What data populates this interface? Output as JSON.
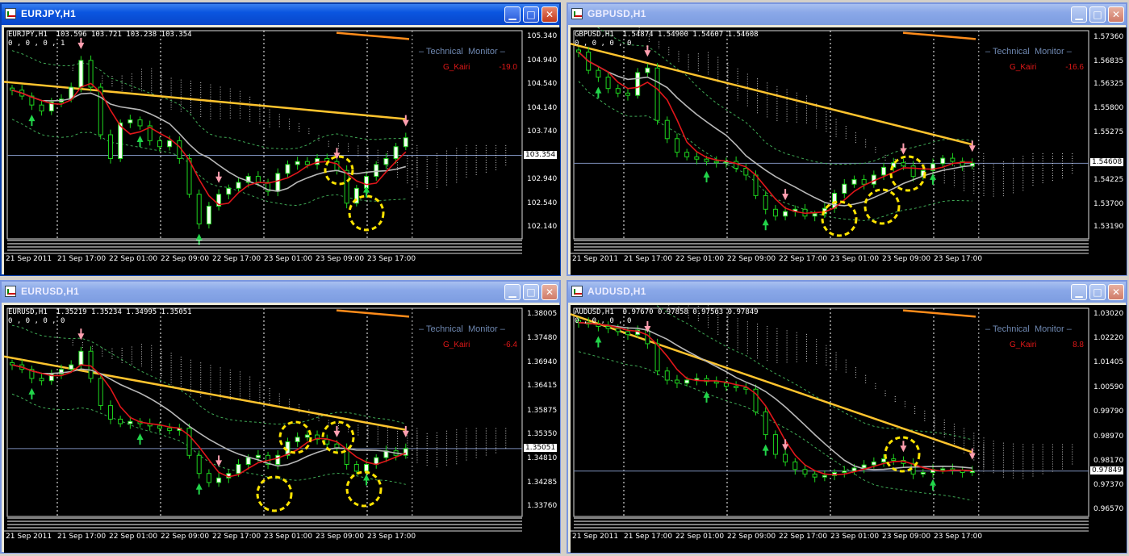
{
  "charts": [
    {
      "id": "eurjpy",
      "title": "EURJPY,H1",
      "active": true,
      "info_line1": "EURJPY,H1  103.596 103.721 103.238 103.354",
      "info_line2": "0 , 0 , 0 , 1",
      "monitor_label": "Technical  Monitor",
      "kairi_label": "G_Kairi",
      "kairi_value": "-19.0",
      "price_labels": [
        "105.340",
        "104.940",
        "104.540",
        "104.140",
        "103.740",
        "103.354",
        "102.940",
        "102.540",
        "102.140"
      ],
      "current_price": "103.354",
      "time_labels": [
        "21 Sep 2011",
        "21 Sep 17:00",
        "22 Sep 01:00",
        "22 Sep 09:00",
        "22 Sep 17:00",
        "23 Sep 01:00",
        "23 Sep 09:00",
        "23 Sep 17:00"
      ],
      "chart_data": {
        "type": "candlestick",
        "ylim": [
          101.95,
          105.45
        ],
        "current": 103.354,
        "close": [
          104.45,
          104.35,
          104.2,
          104.1,
          104.25,
          104.3,
          104.5,
          104.95,
          104.5,
          103.7,
          103.3,
          103.9,
          103.95,
          103.85,
          103.6,
          103.5,
          103.6,
          103.3,
          102.7,
          102.2,
          102.5,
          102.7,
          102.8,
          102.9,
          103.0,
          102.9,
          102.75,
          103.05,
          103.2,
          103.25,
          103.2,
          103.3,
          103.25,
          103.1,
          102.55,
          102.8,
          103.0,
          103.2,
          103.3,
          103.5,
          103.65
        ]
      },
      "circles": [
        [
          415,
          177,
          17
        ],
        [
          449,
          230,
          21
        ]
      ]
    },
    {
      "id": "gbpusd",
      "title": "GBPUSD,H1",
      "active": false,
      "info_line1": "GBPUSD,H1  1.54874 1.54900 1.54607 1.54608",
      "info_line2": "0 , 0 , 0 , 0",
      "monitor_label": "Technical  Monitor",
      "kairi_label": "G_Kairi",
      "kairi_value": "-16.6",
      "price_labels": [
        "1.57360",
        "1.56835",
        "1.56325",
        "1.55800",
        "1.55275",
        "1.54608",
        "1.54225",
        "1.53700",
        "1.53190"
      ],
      "current_price": "1.54608",
      "time_labels": [
        "21 Sep 2011",
        "21 Sep 17:00",
        "22 Sep 01:00",
        "22 Sep 09:00",
        "22 Sep 17:00",
        "23 Sep 01:00",
        "23 Sep 09:00",
        "23 Sep 17:00"
      ],
      "chart_data": {
        "type": "candlestick",
        "ylim": [
          1.5295,
          1.5752
        ],
        "current": 1.54608,
        "close": [
          1.5705,
          1.5665,
          1.565,
          1.5625,
          1.5615,
          1.561,
          1.566,
          1.567,
          1.5555,
          1.5515,
          1.5485,
          1.5475,
          1.547,
          1.5465,
          1.5462,
          1.5465,
          1.545,
          1.5435,
          1.539,
          1.536,
          1.5345,
          1.5355,
          1.536,
          1.5345,
          1.535,
          1.5362,
          1.5395,
          1.5415,
          1.5425,
          1.5415,
          1.5435,
          1.5452,
          1.5462,
          1.5455,
          1.5432,
          1.5445,
          1.546,
          1.5472,
          1.5465,
          1.5455,
          1.5461
        ]
      },
      "circles": [
        [
          333,
          237,
          21
        ],
        [
          386,
          222,
          21
        ],
        [
          418,
          181,
          21
        ]
      ]
    },
    {
      "id": "eurusd",
      "title": "EURUSD,H1",
      "active": false,
      "info_line1": "EURUSD,H1  1.35219 1.35234 1.34995 1.35051",
      "info_line2": "0 , 0 , 0 , 0",
      "monitor_label": "Technical  Monitor",
      "kairi_label": "G_Kairi",
      "kairi_value": "-6.4",
      "price_labels": [
        "1.38005",
        "1.37480",
        "1.36940",
        "1.36415",
        "1.35875",
        "1.35350",
        "1.35051",
        "1.34810",
        "1.34285",
        "1.33760"
      ],
      "current_price": "1.35051",
      "time_labels": [
        "21 Sep 2011",
        "21 Sep 17:00",
        "22 Sep 01:00",
        "22 Sep 09:00",
        "22 Sep 17:00",
        "23 Sep 01:00",
        "23 Sep 09:00",
        "23 Sep 17:00"
      ],
      "chart_data": {
        "type": "candlestick",
        "ylim": [
          1.3355,
          1.3815
        ],
        "current": 1.35051,
        "close": [
          1.369,
          1.368,
          1.366,
          1.3655,
          1.367,
          1.368,
          1.369,
          1.372,
          1.366,
          1.36,
          1.357,
          1.356,
          1.3565,
          1.356,
          1.3555,
          1.355,
          1.3545,
          1.355,
          1.349,
          1.345,
          1.343,
          1.344,
          1.345,
          1.347,
          1.3485,
          1.349,
          1.347,
          1.349,
          1.352,
          1.353,
          1.3535,
          1.3525,
          1.3515,
          1.3505,
          1.347,
          1.3455,
          1.347,
          1.3485,
          1.35,
          1.349,
          1.3505
        ]
      },
      "circles": [
        [
          361,
          164,
          19
        ],
        [
          414,
          164,
          19
        ],
        [
          335,
          234,
          21
        ],
        [
          446,
          228,
          21
        ]
      ]
    },
    {
      "id": "audusd",
      "title": "AUDUSD,H1",
      "active": false,
      "info_line1": "AUDUSD,H1  0.97670 0.97858 0.97563 0.97849",
      "info_line2": "0 , 0 , 0 , 0",
      "monitor_label": "Technical  Monitor",
      "kairi_label": "G_Kairi",
      "kairi_value": "8.8",
      "price_labels": [
        "1.03020",
        "1.02220",
        "1.01405",
        "1.00590",
        "0.99790",
        "0.98970",
        "0.98170",
        "0.97849",
        "0.97370",
        "0.96570"
      ],
      "current_price": "0.97849",
      "time_labels": [
        "21 Sep 2011",
        "21 Sep 17:00",
        "22 Sep 01:00",
        "22 Sep 09:00",
        "22 Sep 17:00",
        "23 Sep 01:00",
        "23 Sep 09:00",
        "23 Sep 17:00"
      ],
      "chart_data": {
        "type": "candlestick",
        "ylim": [
          0.9635,
          1.0322
        ],
        "current": 0.97849,
        "close": [
          1.0275,
          1.027,
          1.0262,
          1.0255,
          1.0245,
          1.0235,
          1.025,
          1.0205,
          1.0115,
          1.0085,
          1.0075,
          1.0085,
          1.009,
          1.008,
          1.0075,
          1.0065,
          1.006,
          1.0055,
          0.998,
          0.9905,
          0.984,
          0.9815,
          0.979,
          0.9775,
          0.9765,
          0.977,
          0.978,
          0.9785,
          0.9795,
          0.9805,
          0.9815,
          0.9825,
          0.982,
          0.981,
          0.9775,
          0.978,
          0.979,
          0.9792,
          0.9788,
          0.978,
          0.9785
        ]
      },
      "circles": [
        [
          411,
          185,
          21
        ]
      ]
    }
  ]
}
